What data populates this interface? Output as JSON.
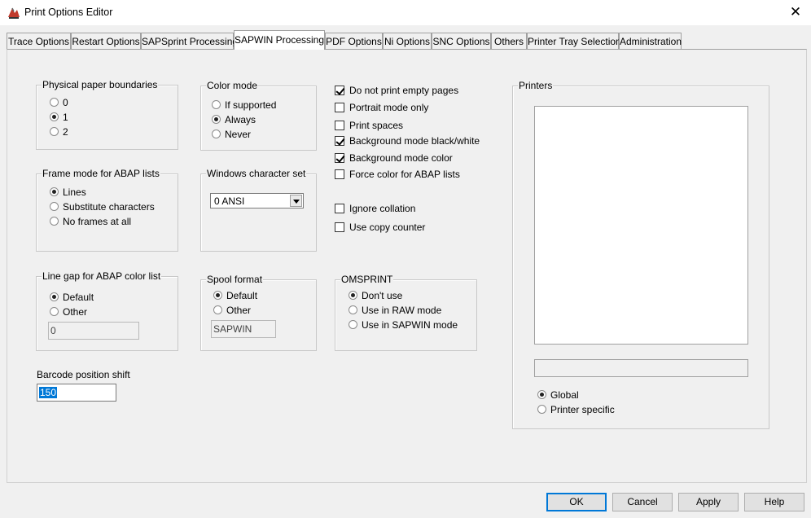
{
  "window": {
    "title": "Print Options Editor",
    "close_glyph": "✕"
  },
  "tabs": [
    {
      "label": "Trace Options"
    },
    {
      "label": "Restart Options"
    },
    {
      "label": "SAPSprint Processing"
    },
    {
      "label": "SAPWIN Processing",
      "active": true
    },
    {
      "label": "PDF Options"
    },
    {
      "label": "Ni Options"
    },
    {
      "label": "SNC Options"
    },
    {
      "label": "Others"
    },
    {
      "label": "Printer Tray Selection"
    },
    {
      "label": "Administration"
    }
  ],
  "paper": {
    "title": "Physical paper boundaries",
    "options": [
      "0",
      "1",
      "2"
    ],
    "selected": "1"
  },
  "color_mode": {
    "title": "Color mode",
    "options": [
      "If supported",
      "Always",
      "Never"
    ],
    "selected": "Always"
  },
  "frame_mode": {
    "title": "Frame mode for ABAP lists",
    "options": [
      "Lines",
      "Substitute characters",
      "No frames at all"
    ],
    "selected": "Lines"
  },
  "charset": {
    "title": "Windows character set",
    "value": "0 ANSI"
  },
  "line_gap": {
    "title": "Line gap for ABAP color list",
    "options": [
      "Default",
      "Other"
    ],
    "selected": "Default",
    "value": "0"
  },
  "spool_format": {
    "title": "Spool format",
    "options": [
      "Default",
      "Other"
    ],
    "selected": "Default",
    "value": "SAPWIN"
  },
  "omsprint": {
    "title": "OMSPRINT",
    "options": [
      "Don't use",
      "Use in RAW mode",
      "Use in SAPWIN mode"
    ],
    "selected": "Don't use"
  },
  "checks": [
    {
      "label": "Do not print empty pages",
      "checked": true
    },
    {
      "label": "Portrait mode only",
      "checked": false
    },
    {
      "label": "Print spaces",
      "checked": false
    },
    {
      "label": "Background mode black/white",
      "checked": true
    },
    {
      "label": "Background mode color",
      "checked": true
    },
    {
      "label": "Force color for ABAP lists",
      "checked": false
    },
    {
      "label": "Ignore collation",
      "checked": false
    },
    {
      "label": "Use copy counter",
      "checked": false
    }
  ],
  "barcode": {
    "label": "Barcode position shift",
    "value": "150"
  },
  "printers": {
    "title": "Printers",
    "scope_options": [
      "Global",
      "Printer specific"
    ],
    "selected": "Global"
  },
  "buttons": {
    "ok": "OK",
    "cancel": "Cancel",
    "apply": "Apply",
    "help": "Help"
  }
}
